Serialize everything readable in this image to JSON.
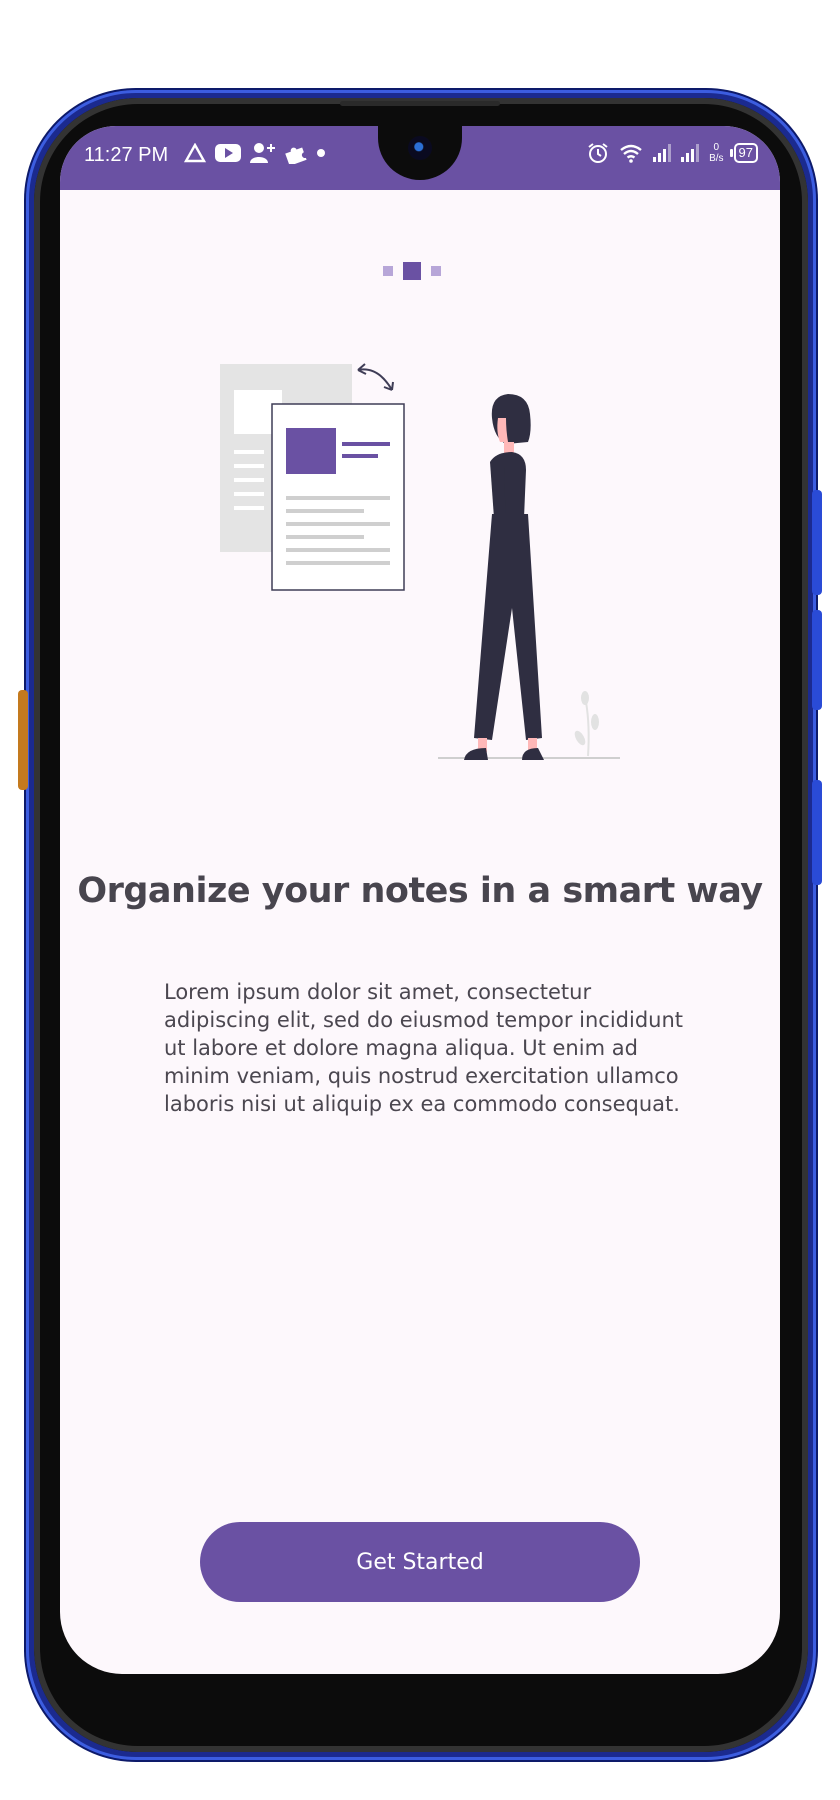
{
  "status_bar": {
    "time": "11:27 PM",
    "net_speed_value": "0",
    "net_speed_unit": "B/s",
    "battery": "97",
    "icons_left": [
      "triangle-app-icon",
      "youtube-icon",
      "add-person-icon",
      "puzzle-icon",
      "dot-icon"
    ],
    "icons_right": [
      "alarm-icon",
      "wifi-icon",
      "signal-icon",
      "signal-icon",
      "battery-icon"
    ]
  },
  "onboarding": {
    "pager": {
      "count": 3,
      "active_index": 1
    },
    "title": "Organize your notes in a smart way",
    "description": "Lorem ipsum dolor sit amet, consectetur adipiscing elit, sed do eiusmod tempor incididunt ut labore et dolore magna aliqua. Ut enim ad minim veniam, quis nostrud exercitation ullamco laboris nisi ut aliquip ex ea commodo consequat.",
    "cta_label": "Get Started"
  },
  "colors": {
    "primary": "#6a51a3",
    "background": "#fdf8fc",
    "text_primary": "#48454e"
  }
}
